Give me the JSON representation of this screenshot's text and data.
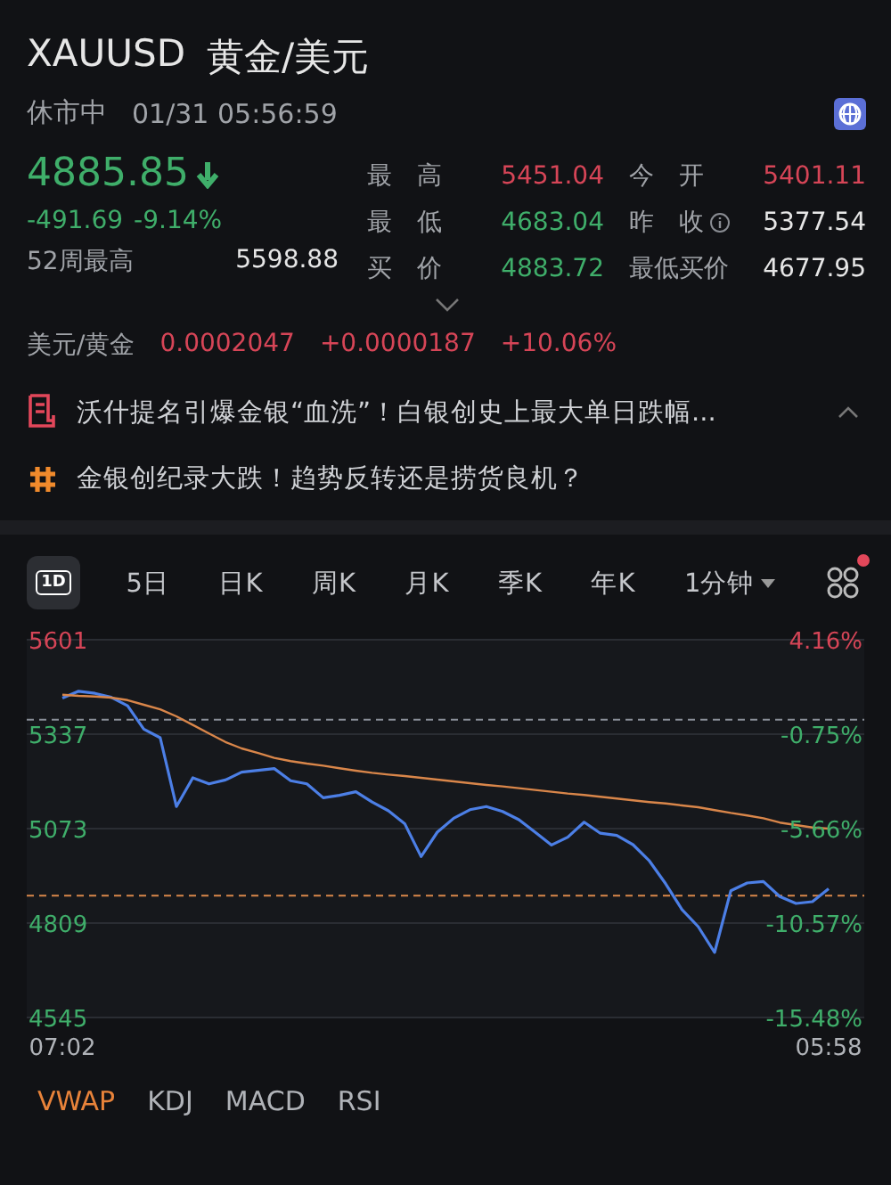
{
  "header": {
    "symbol": "XAUUSD",
    "name": "黄金/美元",
    "status": "休市中",
    "datetime": "01/31 05:56:59"
  },
  "quote": {
    "price": "4885.85",
    "color": "#3fae6a",
    "falling": true,
    "change": "-491.69",
    "change_pct": "-9.14%",
    "week52_label": "52周最高",
    "week52_value": "5598.88"
  },
  "stats": [
    {
      "label": "最　高",
      "value": "5451.04",
      "color": "#d64557",
      "info": false
    },
    {
      "label": "今　开",
      "value": "5401.11",
      "color": "#d64557",
      "info": false
    },
    {
      "label": "最　低",
      "value": "4683.04",
      "color": "#3fae6a",
      "info": false
    },
    {
      "label": "昨　收",
      "value": "5377.54",
      "color": "#e6e6e6",
      "info": true
    },
    {
      "label": "买　价",
      "value": "4883.72",
      "color": "#3fae6a",
      "info": false
    },
    {
      "label": "最低买价",
      "value": "4677.95",
      "color": "#e6e6e6",
      "info": false
    }
  ],
  "conversion": {
    "label": "美元/黄金",
    "value": "0.0002047",
    "change": "+0.0000187",
    "change_pct": "+10.06%",
    "color": "#d64557"
  },
  "news": [
    {
      "kind": "article",
      "text": "沃什提名引爆金银“血洗”！白银创史上最大单日跌幅...",
      "toggle": true
    },
    {
      "kind": "topic",
      "text": "金银创纪录大跌！趋势反转还是捞货良机？",
      "toggle": false
    }
  ],
  "period_tabs": [
    {
      "kind": "icon",
      "label": "1D",
      "selected": true
    },
    {
      "kind": "text",
      "label": "5日",
      "selected": false
    },
    {
      "kind": "text",
      "label": "日K",
      "selected": false
    },
    {
      "kind": "text",
      "label": "周K",
      "selected": false
    },
    {
      "kind": "text",
      "label": "月K",
      "selected": false
    },
    {
      "kind": "text",
      "label": "季K",
      "selected": false
    },
    {
      "kind": "text",
      "label": "年K",
      "selected": false
    },
    {
      "kind": "dropdown",
      "label": "1分钟",
      "selected": false
    }
  ],
  "layout_button": {
    "badge": true
  },
  "chart": {
    "percent_labels": [
      "4.16%",
      "-0.75%",
      "-5.66%",
      "-10.57%",
      "-15.48%"
    ],
    "chart_data": {
      "type": "line",
      "categories": [
        "07:02",
        null,
        null,
        null,
        null,
        null,
        null,
        null,
        null,
        null,
        null,
        null,
        null,
        null,
        null,
        null,
        null,
        null,
        null,
        null,
        null,
        null,
        null,
        null,
        null,
        null,
        null,
        null,
        null,
        null,
        null,
        null,
        null,
        null,
        null,
        null,
        null,
        null,
        null,
        null,
        null,
        null,
        null,
        null,
        null,
        null,
        null,
        "05:58"
      ],
      "ylim": [
        4545,
        5601
      ],
      "grid": true,
      "yticks": [
        {
          "value": 5601,
          "label": "5601"
        },
        {
          "value": 5337,
          "label": "5337"
        },
        {
          "value": 5073,
          "label": "5073"
        },
        {
          "value": 4809,
          "label": "4809"
        },
        {
          "value": 4545,
          "label": "4545"
        }
      ],
      "series": [
        {
          "color": "#4c7fe6",
          "values": [
            5438,
            5457,
            5451,
            5440,
            5416,
            5351,
            5327,
            5135,
            5215,
            5198,
            5209,
            5231,
            5236,
            5241,
            5207,
            5198,
            5159,
            5166,
            5176,
            5147,
            5123,
            5087,
            4995,
            5063,
            5102,
            5126,
            5135,
            5121,
            5098,
            5063,
            5027,
            5049,
            5091,
            5060,
            5054,
            5028,
            4983,
            4919,
            4847,
            4799,
            4727,
            4899,
            4921,
            4925,
            4883,
            4864,
            4869,
            4905
          ]
        },
        {
          "color": "#d9864a",
          "values": [
            5447,
            5444,
            5442,
            5439,
            5432,
            5419,
            5406,
            5387,
            5363,
            5339,
            5315,
            5297,
            5284,
            5271,
            5262,
            5255,
            5249,
            5242,
            5235,
            5229,
            5224,
            5220,
            5215,
            5210,
            5205,
            5200,
            5195,
            5191,
            5186,
            5181,
            5176,
            5171,
            5167,
            5162,
            5157,
            5152,
            5147,
            5143,
            5138,
            5133,
            5125,
            5117,
            5110,
            5102,
            5090,
            5083,
            5076,
            5073
          ]
        }
      ],
      "ref_lines": [
        {
          "axis": "y",
          "value": 5377.54,
          "color": "#8a8f99"
        },
        {
          "axis": "y",
          "value": 4885.85,
          "color": "#d9864a"
        }
      ]
    }
  },
  "indicator_tabs": [
    {
      "label": "VWAP",
      "selected": true
    },
    {
      "label": "KDJ",
      "selected": false
    },
    {
      "label": "MACD",
      "selected": false
    },
    {
      "label": "RSI",
      "selected": false
    }
  ]
}
